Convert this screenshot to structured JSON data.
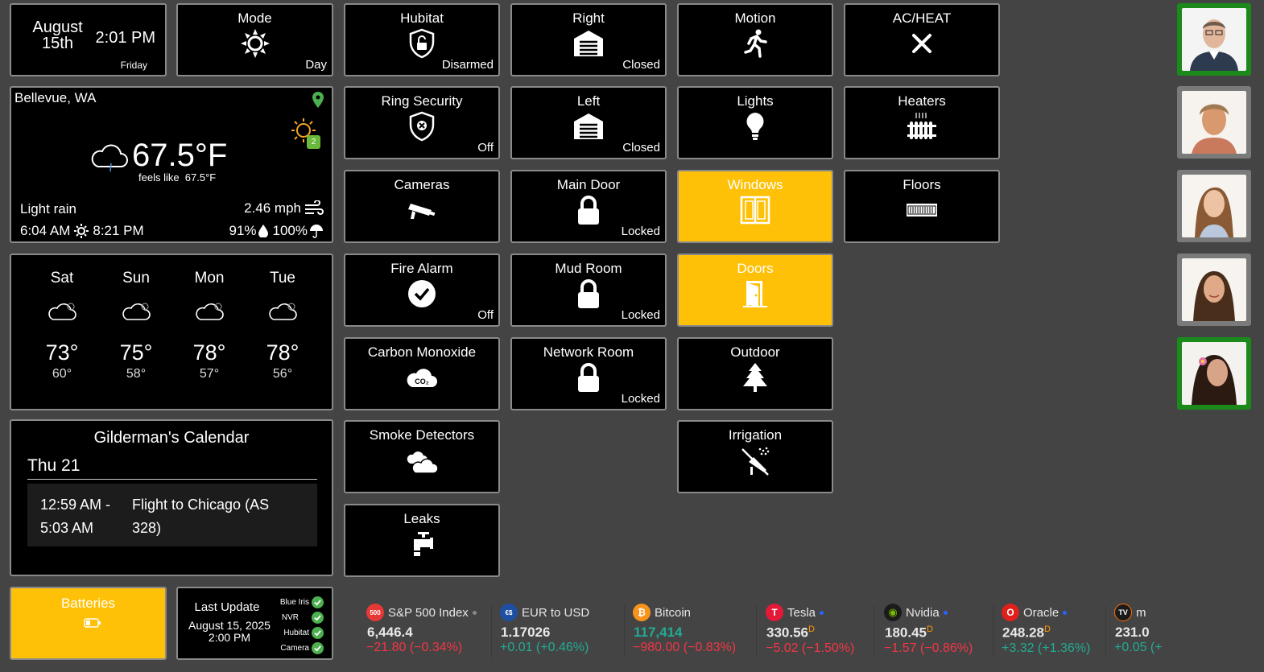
{
  "datetime": {
    "date": "August\n15th",
    "time": "2:01 PM",
    "day": "Friday"
  },
  "mode": {
    "title": "Mode",
    "status": "Day"
  },
  "weather": {
    "location": "Bellevue, WA",
    "temp": "67.5°F",
    "feels_like": "feels like  67.5°F",
    "condition": "Light rain",
    "wind": "2.46 mph",
    "sunrise": "6:04 AM",
    "sunset": "8:21 PM",
    "humidity": "91%",
    "precip": "100%",
    "alert_count": "2"
  },
  "forecast": [
    {
      "day": "Sat",
      "hi": "73°",
      "lo": "60°"
    },
    {
      "day": "Sun",
      "hi": "75°",
      "lo": "58°"
    },
    {
      "day": "Mon",
      "hi": "78°",
      "lo": "57°"
    },
    {
      "day": "Tue",
      "hi": "78°",
      "lo": "56°"
    }
  ],
  "calendar": {
    "title": "Gilderman's Calendar",
    "date": "Thu 21",
    "event_time": "12:59 AM - 5:03 AM",
    "event_title": "Flight to Chicago (AS 328)"
  },
  "batteries": {
    "title": "Batteries"
  },
  "last_update": {
    "label": "Last Update",
    "date": "August 15, 2025",
    "time": "2:00 PM",
    "services": [
      "Blue Iris",
      "NVR",
      "Hubitat",
      "Camera"
    ]
  },
  "tiles": {
    "hubitat": {
      "title": "Hubitat",
      "status": "Disarmed"
    },
    "right": {
      "title": "Right",
      "status": "Closed"
    },
    "motion": {
      "title": "Motion",
      "status": ""
    },
    "acheat": {
      "title": "AC/HEAT",
      "status": ""
    },
    "ring": {
      "title": "Ring Security",
      "status": "Off"
    },
    "left": {
      "title": "Left",
      "status": "Closed"
    },
    "lights": {
      "title": "Lights",
      "status": ""
    },
    "heaters": {
      "title": "Heaters",
      "status": ""
    },
    "cameras": {
      "title": "Cameras",
      "status": ""
    },
    "maindoor": {
      "title": "Main Door",
      "status": "Locked"
    },
    "windows": {
      "title": "Windows",
      "status": ""
    },
    "floors": {
      "title": "Floors",
      "status": ""
    },
    "fire": {
      "title": "Fire Alarm",
      "status": "Off"
    },
    "mudroom": {
      "title": "Mud Room",
      "status": "Locked"
    },
    "doors": {
      "title": "Doors",
      "status": ""
    },
    "co": {
      "title": "Carbon Monoxide",
      "status": ""
    },
    "network": {
      "title": "Network Room",
      "status": "Locked"
    },
    "outdoor": {
      "title": "Outdoor",
      "status": ""
    },
    "smoke": {
      "title": "Smoke Detectors",
      "status": ""
    },
    "irrigation": {
      "title": "Irrigation",
      "status": ""
    },
    "leaks": {
      "title": "Leaks",
      "status": ""
    }
  },
  "ticker": [
    {
      "name": "S&P 500 Index",
      "logo": "500",
      "price": "6,446.4",
      "suffix": "",
      "change": "−21.80 (−0.34%)",
      "dir": "down",
      "logo_color": "#e53935"
    },
    {
      "name": "EUR to USD",
      "logo": "€$",
      "price": "1.17026",
      "suffix": "",
      "change": "+0.01 (+0.46%)",
      "dir": "up",
      "logo_color": "#1e4fa1"
    },
    {
      "name": "Bitcoin",
      "logo": "₿",
      "price": "117,414",
      "suffix": "",
      "change": "−980.00 (−0.83%)",
      "dir": "down",
      "logo_color": "#f7931a"
    },
    {
      "name": "Tesla",
      "logo": "T",
      "price": "330.56",
      "suffix": "D",
      "change": "−5.02 (−1.50%)",
      "dir": "down",
      "logo_color": "#e31937"
    },
    {
      "name": "Nvidia",
      "logo": "◉",
      "price": "180.45",
      "suffix": "D",
      "change": "−1.57 (−0.86%)",
      "dir": "down",
      "logo_color": "#1b1b1b"
    },
    {
      "name": "Oracle",
      "logo": "O",
      "price": "248.28",
      "suffix": "D",
      "change": "+3.32 (+1.36%)",
      "dir": "up",
      "logo_color": "#e0201b"
    },
    {
      "name": "m",
      "logo": "TV",
      "price": "231.0",
      "suffix": "",
      "change": "+0.05 (+",
      "dir": "up",
      "logo_color": "#1b1b1b"
    }
  ],
  "colors": {
    "background": "#444444",
    "tile": "#000000",
    "active": "#ffc107",
    "presence_home": "#1b8a1b",
    "presence_away": "#7a7a7a"
  }
}
